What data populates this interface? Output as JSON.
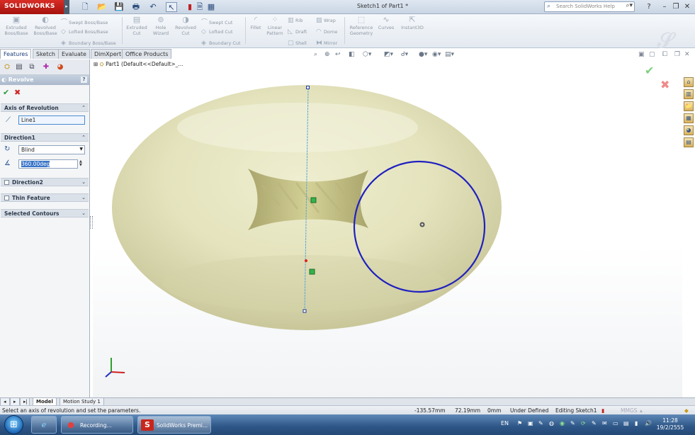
{
  "app": {
    "logo": "SOLIDWORKS",
    "document_title": "Sketch1 of Part1 *"
  },
  "search": {
    "placeholder": "Search SolidWorks Help"
  },
  "toolbar": {
    "extruded_boss": [
      "Extruded",
      "Boss/Base"
    ],
    "revolved_boss": [
      "Revolved",
      "Boss/Base"
    ],
    "swept_boss": "Swept Boss/Base",
    "lofted_boss": "Lofted Boss/Base",
    "boundary_boss": "Boundary Boss/Base",
    "extruded_cut": [
      "Extruded",
      "Cut"
    ],
    "hole_wizard": [
      "Hole",
      "Wizard"
    ],
    "revolved_cut": [
      "Revolved",
      "Cut"
    ],
    "swept_cut": "Swept Cut",
    "lofted_cut": "Lofted Cut",
    "boundary_cut": "Boundary Cut",
    "fillet": "Fillet",
    "linear_pattern": [
      "Linear",
      "Pattern"
    ],
    "rib": "Rib",
    "draft": "Draft",
    "shell": "Shell",
    "wrap": "Wrap",
    "dome": "Dome",
    "mirror": "Mirror",
    "reference_geometry": [
      "Reference",
      "Geometry"
    ],
    "curves": "Curves",
    "instant3d": "Instant3D"
  },
  "tabs": [
    "Features",
    "Sketch",
    "Evaluate",
    "DimXpert",
    "Office Products"
  ],
  "property_manager": {
    "title": "Revolve",
    "help": "?",
    "axis_group": "Axis of Revolution",
    "axis_value": "Line1",
    "direction1_group": "Direction1",
    "direction1_type": "Blind",
    "direction1_angle": "360.00deg",
    "direction2_group": "Direction2",
    "thin_feature_group": "Thin Feature",
    "selected_contours_group": "Selected Contours"
  },
  "tree": {
    "label": "Part1 (Default<<Default>_..."
  },
  "model_tabs": [
    "Model",
    "Motion Study 1"
  ],
  "status": {
    "message": "Select an axis of revolution and set the parameters.",
    "x": "-135.57mm",
    "y": "72.19mm",
    "z": "0mm",
    "definition": "Under Defined",
    "editing": "Editing Sketch1",
    "units": "MMGS"
  },
  "taskbar": {
    "items": [
      "Recording...",
      "SolidWorks Premi..."
    ],
    "language": "EN",
    "time": "11:28",
    "date": "19/2/2555"
  },
  "colors": {
    "torus": "#e4e3bd",
    "sketch_circle": "#2020c0",
    "axis_line": "#5aa8d8",
    "accent": "#1f4e8c"
  }
}
